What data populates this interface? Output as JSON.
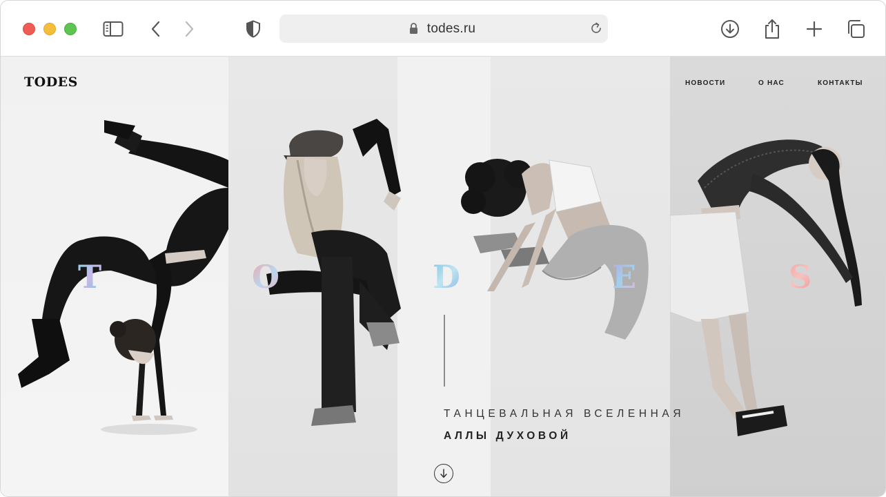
{
  "browser": {
    "url": "todes.ru",
    "icons": {
      "sidebar": "sidebar-icon",
      "back": "chevron-left-icon",
      "forward": "chevron-right-icon",
      "privacy": "shield-icon",
      "lock": "lock-icon",
      "reload": "reload-icon",
      "download": "download-icon",
      "share": "share-icon",
      "new_tab": "plus-icon",
      "tabs": "tabs-overview-icon"
    },
    "colors": {
      "close": "#ee5c54",
      "minimize": "#f5bd3a",
      "maximize": "#5fc452"
    }
  },
  "site": {
    "logo": "TODES",
    "nav": [
      "НОВОСТИ",
      "О НАС",
      "КОНТАКТЫ"
    ],
    "letters": [
      "T",
      "O",
      "D",
      "E",
      "S"
    ],
    "tagline_line1": "ТАНЦЕВАЛЬНАЯ ВСЕЛЕННАЯ",
    "tagline_line2": "АЛЛЫ ДУХОВОЙ",
    "scroll_icon": "arrow-down-icon"
  }
}
